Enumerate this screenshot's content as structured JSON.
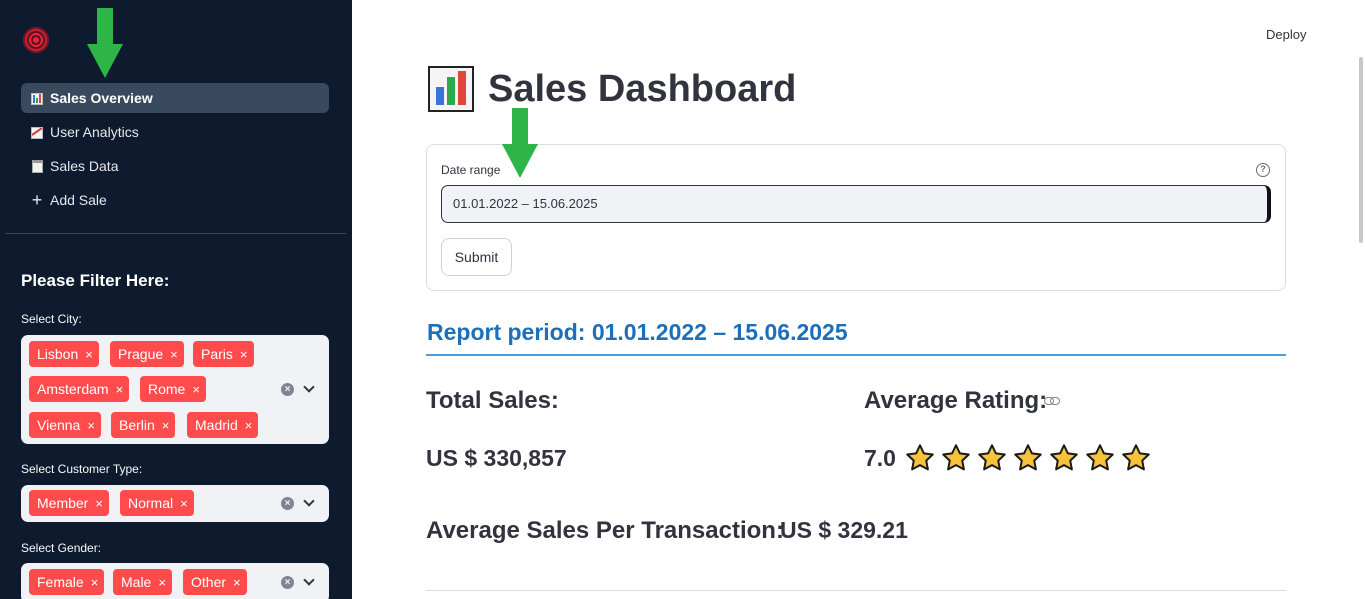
{
  "sidebar": {
    "nav_items": [
      {
        "label": "Sales Overview",
        "icon": "bar-chart-icon",
        "active": true
      },
      {
        "label": "User Analytics",
        "icon": "line-chart-icon",
        "active": false
      },
      {
        "label": "Sales Data",
        "icon": "clipboard-icon",
        "active": false
      },
      {
        "label": "Add Sale",
        "icon": "plus-icon",
        "active": false
      }
    ],
    "filter_title": "Please Filter Here:",
    "city": {
      "label": "Select City:",
      "selected": [
        "Lisbon",
        "Prague",
        "Paris",
        "Amsterdam",
        "Rome",
        "Vienna",
        "Berlin",
        "Madrid"
      ]
    },
    "customer_type": {
      "label": "Select Customer Type:",
      "selected": [
        "Member",
        "Normal"
      ]
    },
    "gender": {
      "label": "Select Gender:",
      "selected": [
        "Female",
        "Male",
        "Other"
      ]
    },
    "chip_remove_glyph": "×"
  },
  "header": {
    "deploy_label": "Deploy"
  },
  "main": {
    "title": "Sales Dashboard",
    "title_icon": "bar-chart-icon",
    "form": {
      "date_label": "Date range",
      "date_value": "01.01.2022 – 15.06.2025",
      "help_glyph": "?",
      "submit_label": "Submit"
    },
    "report_period": "Report period: 01.01.2022 – 15.06.2025",
    "total_sales": {
      "label": "Total Sales:",
      "value": "US $ 330,857"
    },
    "average_rating": {
      "label": "Average Rating:",
      "value": "7.0",
      "stars": 7
    },
    "avg_per_transaction": {
      "label": "Average Sales Per Transaction:",
      "value": "US $ 329.21"
    }
  },
  "colors": {
    "sidebar_bg": "#0e1a2e",
    "chip": "#ff4b4b",
    "accent_blue": "#1c6fb8",
    "annotation_arrow": "#2db548",
    "star": "#f7c23a"
  }
}
